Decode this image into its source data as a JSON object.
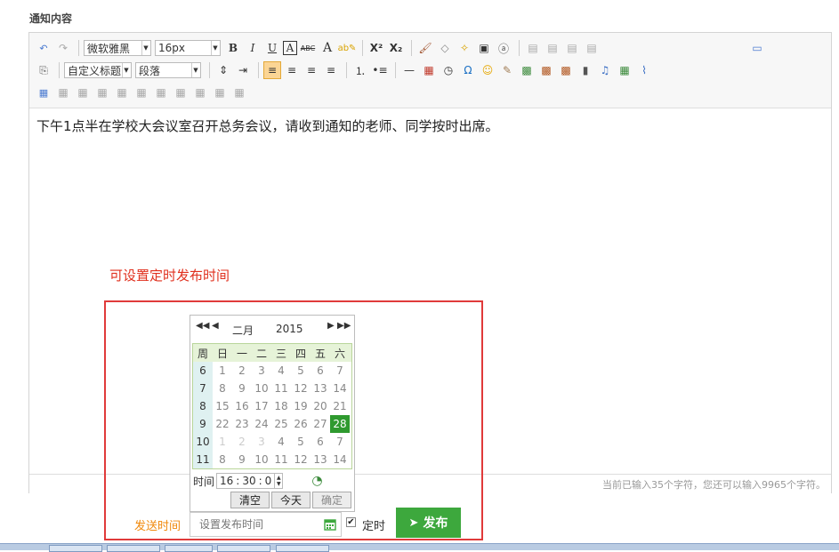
{
  "section_label": "通知内容",
  "toolbar": {
    "font_family": "微软雅黑",
    "font_size": "16px",
    "custom_heading": "自定义标题",
    "paragraph": "段落",
    "bold": "B",
    "italic": "I",
    "underline": "U",
    "font_border": "A",
    "strike": "ABC",
    "font_color": "A",
    "superscript": "X²",
    "subscript": "X₂",
    "omega": "Ω"
  },
  "editor": {
    "content": "下午1点半在学校大会议室召开总务会议，请收到通知的老师、同学按时出席。",
    "counter": "当前已输入35个字符，您还可以输入9965个字符。"
  },
  "hint": "可设置定时发布时间",
  "calendar": {
    "month": "二月",
    "year": "2015",
    "headers": [
      "周",
      "日",
      "一",
      "二",
      "三",
      "四",
      "五",
      "六"
    ],
    "rows": [
      {
        "week": "6",
        "days": [
          "1",
          "2",
          "3",
          "4",
          "5",
          "6",
          "7"
        ]
      },
      {
        "week": "7",
        "days": [
          "8",
          "9",
          "10",
          "11",
          "12",
          "13",
          "14"
        ]
      },
      {
        "week": "8",
        "days": [
          "15",
          "16",
          "17",
          "18",
          "19",
          "20",
          "21"
        ]
      },
      {
        "week": "9",
        "days": [
          "22",
          "23",
          "24",
          "25",
          "26",
          "27",
          "28"
        ]
      },
      {
        "week": "10",
        "days": [
          "1",
          "2",
          "3",
          "4",
          "5",
          "6",
          "7"
        ]
      },
      {
        "week": "11",
        "days": [
          "8",
          "9",
          "10",
          "11",
          "12",
          "13",
          "14"
        ]
      }
    ],
    "selected_day": "28",
    "time_label": "时间",
    "hour": "16",
    "minute": "30",
    "second": "0",
    "clear": "清空",
    "today": "今天",
    "confirm": "确定"
  },
  "send": {
    "label": "发送时间",
    "placeholder": "设置发布时间",
    "timed_label": "定时",
    "publish": "发布"
  },
  "colors": {
    "accent_green": "#3da83d",
    "hint_red": "#e0301e",
    "label_orange": "#f0890c"
  }
}
